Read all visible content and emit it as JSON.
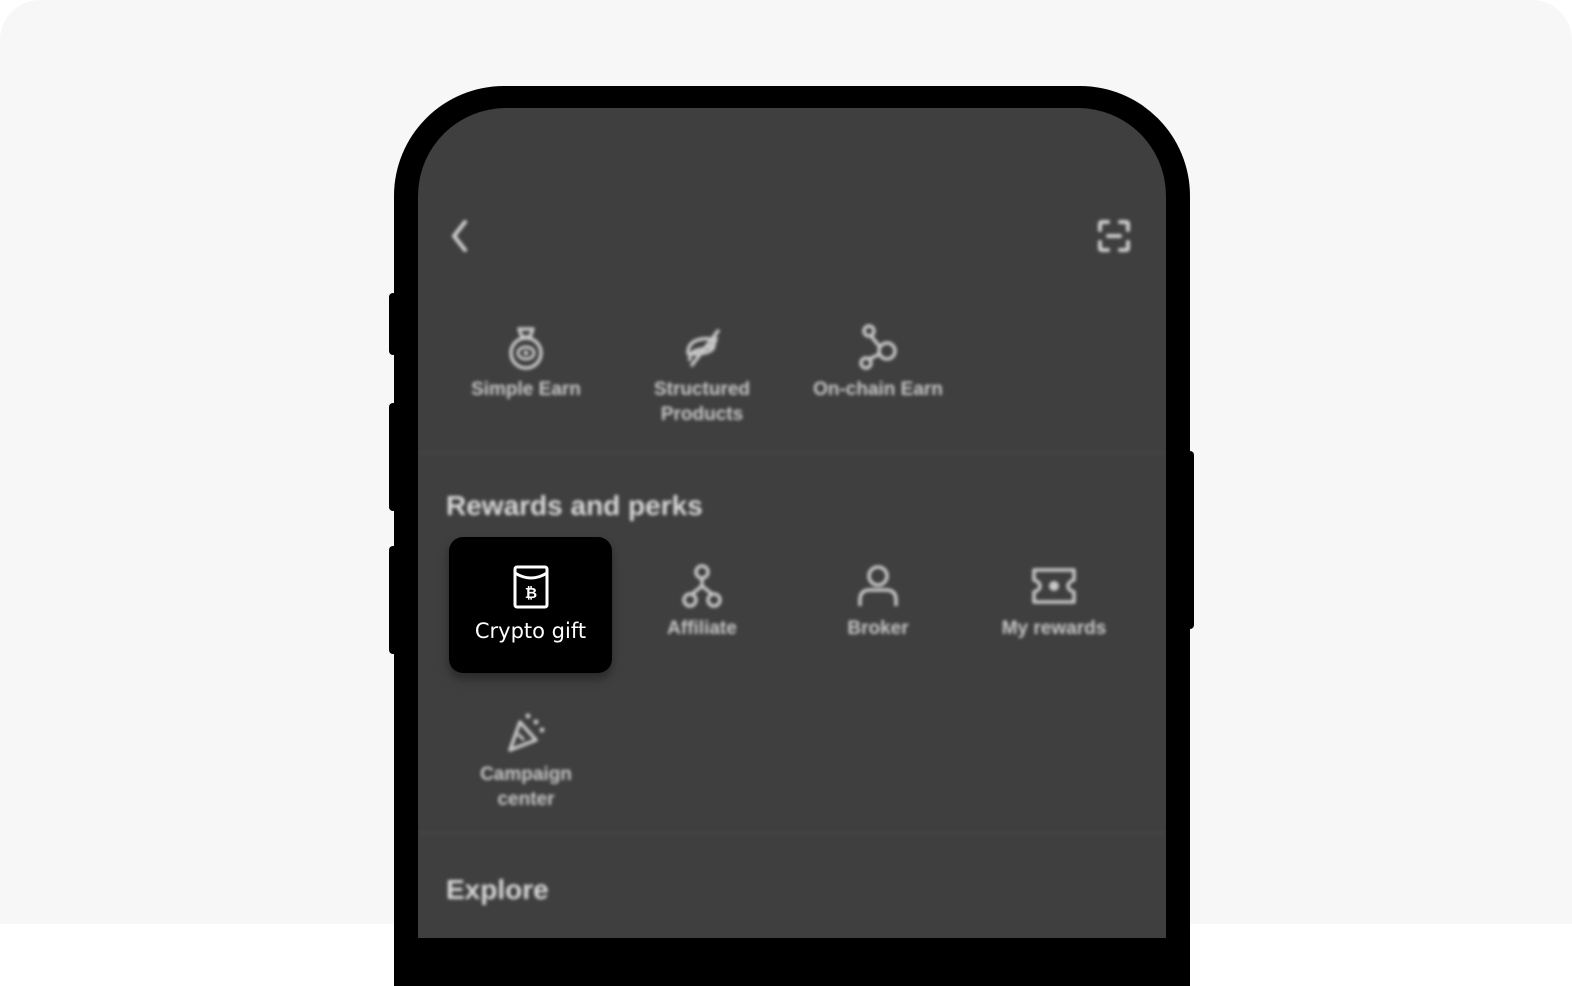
{
  "header": {
    "back_icon": "chevron-left-icon",
    "scan_icon": "scan-icon"
  },
  "earn_section": {
    "items": [
      {
        "label": "Simple Earn",
        "icon": "money-bag-icon"
      },
      {
        "label": "Structured\nProducts",
        "icon": "structured-products-icon"
      },
      {
        "label": "On-chain Earn",
        "icon": "nodes-icon"
      }
    ]
  },
  "rewards_section": {
    "title": "Rewards and perks",
    "items": [
      {
        "label": "Crypto gift",
        "icon": "crypto-gift-envelope-icon",
        "highlighted": true
      },
      {
        "label": "Affiliate",
        "icon": "affiliate-network-icon"
      },
      {
        "label": "Broker",
        "icon": "person-icon"
      },
      {
        "label": "My rewards",
        "icon": "ticket-icon"
      },
      {
        "label": "Campaign\ncenter",
        "icon": "party-popper-icon"
      }
    ]
  },
  "explore_section": {
    "title": "Explore"
  }
}
